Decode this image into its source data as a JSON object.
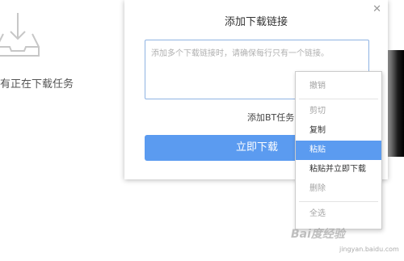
{
  "background": {
    "empty_text": "有正在下载任务"
  },
  "dialog": {
    "title": "添加下载链接",
    "close_icon": "close-icon",
    "input_placeholder": "添加多个下载链接时，请确保每行只有一个链接。",
    "bt_task_label": "添加BT任务",
    "download_button_label": "立即下载"
  },
  "context_menu": {
    "items": [
      {
        "label": "撤销",
        "state": "disabled"
      },
      {
        "label": "剪切",
        "state": "disabled"
      },
      {
        "label": "复制",
        "state": "normal"
      },
      {
        "label": "粘贴",
        "state": "highlighted"
      },
      {
        "label": "粘贴并立即下载",
        "state": "normal"
      },
      {
        "label": "删除",
        "state": "disabled"
      },
      {
        "label": "全选",
        "state": "disabled"
      }
    ]
  },
  "watermark": {
    "text": "Bai度经验",
    "sub": "jingyan.baidu.com"
  },
  "colors": {
    "accent": "#5b9bf0",
    "input_border": "#8fb3e3"
  }
}
